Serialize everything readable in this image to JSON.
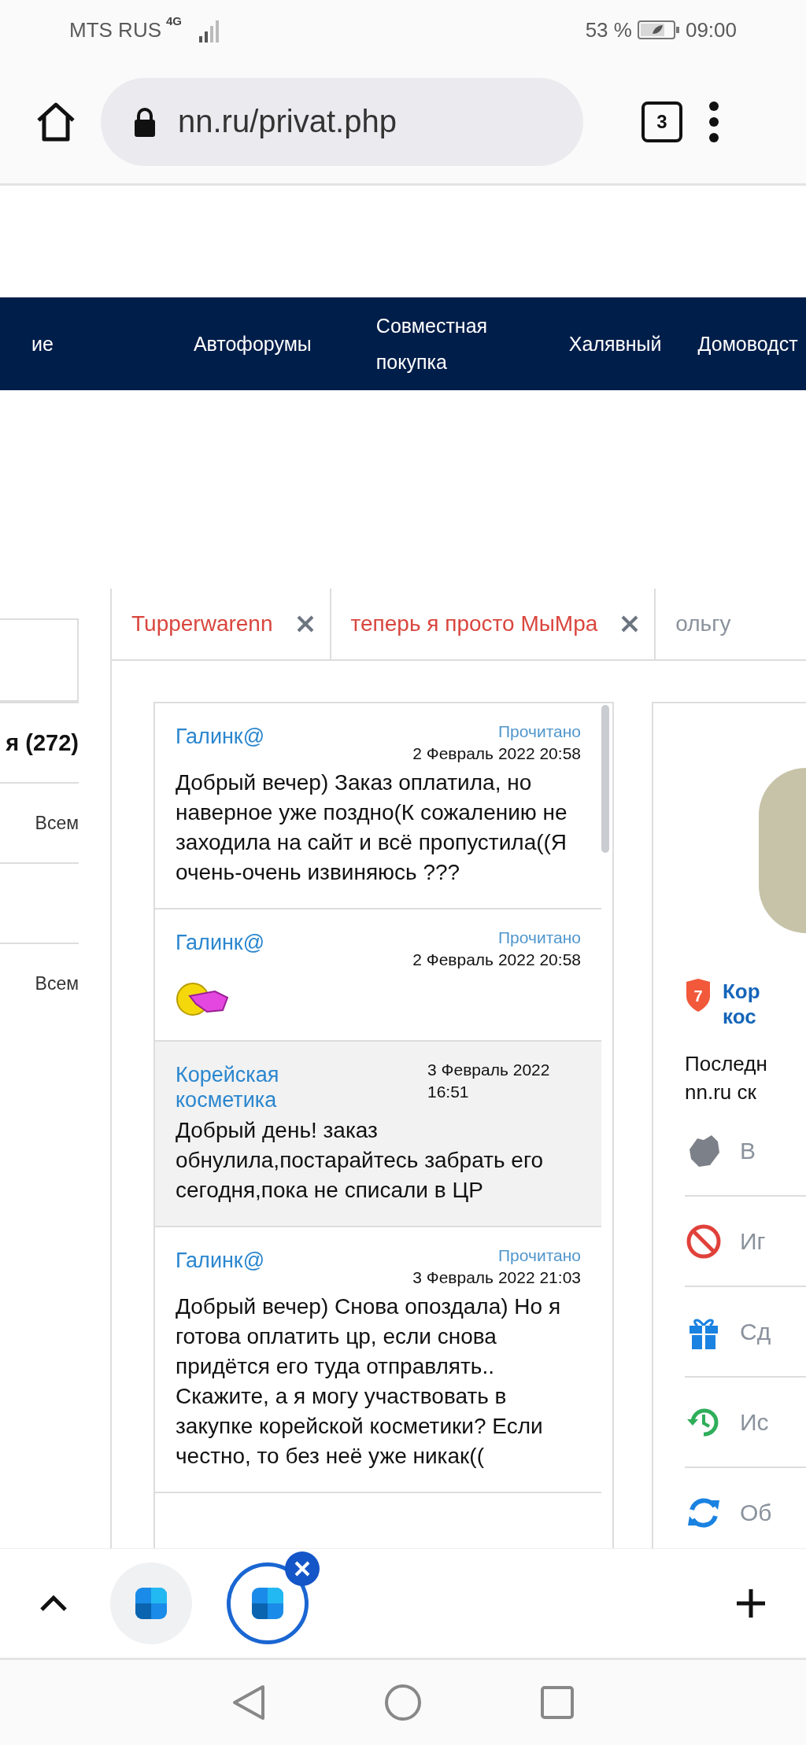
{
  "status_bar": {
    "carrier": "MTS RUS",
    "network": "4G",
    "battery": "53 %",
    "time": "09:00"
  },
  "browser": {
    "url": "nn.ru/privat.php",
    "tab_count": "3"
  },
  "nav": {
    "items": [
      "ие",
      "Автофорумы",
      "Совместная покупка",
      "Халявный",
      "Домоводст"
    ]
  },
  "sidebar": {
    "rows": [
      {
        "kind": "count",
        "label": "я (272)"
      },
      {
        "kind": "audience",
        "label": "Всем"
      },
      {
        "kind": "empty"
      },
      {
        "kind": "audience",
        "label": "Всем"
      }
    ]
  },
  "dialog_tabs": [
    {
      "label": "Tupperwarenn",
      "unread": true,
      "closable": true
    },
    {
      "label": "теперь я просто МыМра",
      "unread": true,
      "closable": true
    },
    {
      "label": "ольгу",
      "unread": false,
      "closable": false
    }
  ],
  "messages": [
    {
      "kind": "text",
      "incoming": false,
      "author": "Галинк@",
      "status": "Прочитано",
      "date": "2 Февраль 2022 20:58",
      "text": "Добрый вечер) Заказ оплатила, но наверное уже поздно(К сожалению не заходила на сайт и всё пропустила((Я очень-очень извиняюсь ???"
    },
    {
      "kind": "sticker",
      "incoming": false,
      "author": "Галинк@",
      "status": "Прочитано",
      "date": "2 Февраль 2022 20:58"
    },
    {
      "kind": "text",
      "incoming": true,
      "author": "Корейская косметика",
      "date": "3 Февраль 2022 16:51",
      "text": "Добрый день! заказ обнулила,постарайтесь забрать его сегодня,пока не списали в ЦР"
    },
    {
      "kind": "text",
      "incoming": false,
      "author": "Галинк@",
      "status": "Прочитано",
      "date": "3 Февраль 2022 21:03",
      "text": "Добрый вечер) Снова опоздала) Но я готова оплатить цр, если снова придётся его туда отправлять.. Скажите, а я могу участвовать в закупке корейской косметики? Если честно, то без неё уже никак(("
    }
  ],
  "profile": {
    "level": "7",
    "name_lines": [
      "Кор",
      "кос"
    ],
    "note_lines": [
      "Последн",
      "nn.ru ск"
    ],
    "actions": [
      {
        "kind": "friend",
        "label": "В"
      },
      {
        "kind": "ignore",
        "label": "Иг"
      },
      {
        "kind": "gift",
        "label": "Сд"
      },
      {
        "kind": "history",
        "label": "Ис"
      },
      {
        "kind": "refresh",
        "label": "Об"
      }
    ]
  }
}
